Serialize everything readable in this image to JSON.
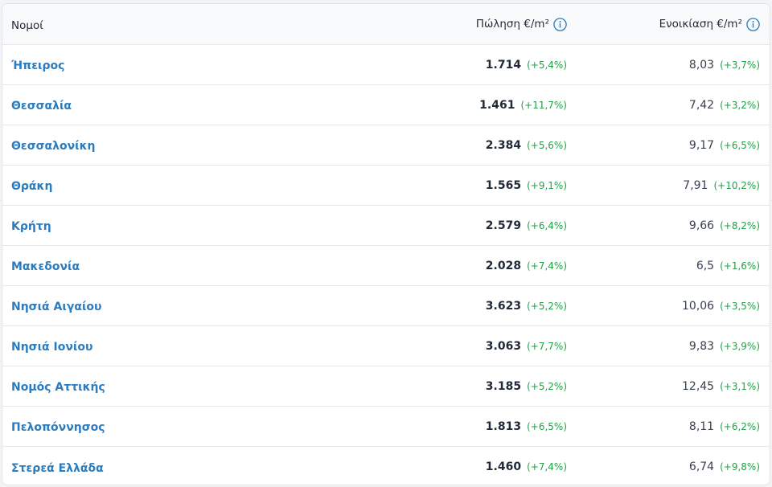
{
  "table": {
    "headers": {
      "region": "Νομοί",
      "sale": "Πώληση €/m²",
      "rent": "Ενοικίαση €/m²"
    },
    "rows": [
      {
        "region": "Ήπειρος",
        "sale": "1.714",
        "sale_change": "(+5,4%)",
        "rent": "8,03",
        "rent_change": "(+3,7%)"
      },
      {
        "region": "Θεσσαλία",
        "sale": "1.461",
        "sale_change": "(+11,7%)",
        "rent": "7,42",
        "rent_change": "(+3,2%)"
      },
      {
        "region": "Θεσσαλονίκη",
        "sale": "2.384",
        "sale_change": "(+5,6%)",
        "rent": "9,17",
        "rent_change": "(+6,5%)"
      },
      {
        "region": "Θράκη",
        "sale": "1.565",
        "sale_change": "(+9,1%)",
        "rent": "7,91",
        "rent_change": "(+10,2%)"
      },
      {
        "region": "Κρήτη",
        "sale": "2.579",
        "sale_change": "(+6,4%)",
        "rent": "9,66",
        "rent_change": "(+8,2%)"
      },
      {
        "region": "Μακεδονία",
        "sale": "2.028",
        "sale_change": "(+7,4%)",
        "rent": "6,5",
        "rent_change": "(+1,6%)"
      },
      {
        "region": "Νησιά Αιγαίου",
        "sale": "3.623",
        "sale_change": "(+5,2%)",
        "rent": "10,06",
        "rent_change": "(+3,5%)"
      },
      {
        "region": "Νησιά Ιονίου",
        "sale": "3.063",
        "sale_change": "(+7,7%)",
        "rent": "9,83",
        "rent_change": "(+3,9%)"
      },
      {
        "region": "Νομός Αττικής",
        "sale": "3.185",
        "sale_change": "(+5,2%)",
        "rent": "12,45",
        "rent_change": "(+3,1%)"
      },
      {
        "region": "Πελοπόννησος",
        "sale": "1.813",
        "sale_change": "(+6,5%)",
        "rent": "8,11",
        "rent_change": "(+6,2%)"
      },
      {
        "region": "Στερεά Ελλάδα",
        "sale": "1.460",
        "sale_change": "(+7,4%)",
        "rent": "6,74",
        "rent_change": "(+9,8%)"
      }
    ]
  },
  "icons": {
    "sale_info": "info-icon",
    "rent_info": "info-icon"
  },
  "colors": {
    "link": "#2b7bbf",
    "positive_change": "#22a04a",
    "info_icon": "#2b7bbf"
  }
}
